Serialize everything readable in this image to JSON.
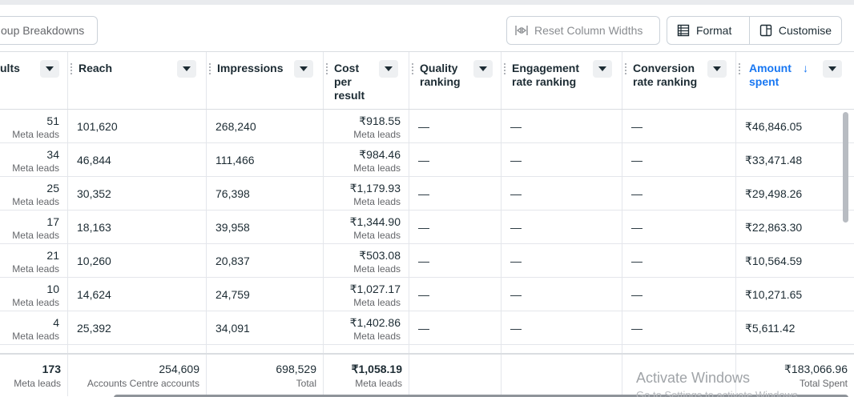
{
  "toolbar": {
    "breakdowns_label": "oup Breakdowns",
    "reset_label": "Reset Column Widths",
    "format_label": "Format",
    "customise_label": "Customise"
  },
  "columns": {
    "results": "ults",
    "reach": "Reach",
    "impressions": "Impressions",
    "cost_l1": "Cost",
    "cost_l2": "per",
    "cost_l3": "result",
    "quality_l1": "Quality",
    "quality_l2": "ranking",
    "engagement_l1": "Engagement",
    "engagement_l2": "rate ranking",
    "conversion_l1": "Conversion",
    "conversion_l2": "rate ranking",
    "amount_l1": "Amount",
    "amount_l2": "spent"
  },
  "rows": [
    {
      "results": "51",
      "results_sub": "Meta leads",
      "reach": "101,620",
      "impressions": "268,240",
      "cost": "₹918.55",
      "cost_sub": "Meta leads",
      "quality": "—",
      "engagement": "—",
      "conversion": "—",
      "amount": "₹46,846.05"
    },
    {
      "results": "34",
      "results_sub": "Meta leads",
      "reach": "46,844",
      "impressions": "111,466",
      "cost": "₹984.46",
      "cost_sub": "Meta leads",
      "quality": "—",
      "engagement": "—",
      "conversion": "—",
      "amount": "₹33,471.48"
    },
    {
      "results": "25",
      "results_sub": "Meta leads",
      "reach": "30,352",
      "impressions": "76,398",
      "cost": "₹1,179.93",
      "cost_sub": "Meta leads",
      "quality": "—",
      "engagement": "—",
      "conversion": "—",
      "amount": "₹29,498.26"
    },
    {
      "results": "17",
      "results_sub": "Meta leads",
      "reach": "18,163",
      "impressions": "39,958",
      "cost": "₹1,344.90",
      "cost_sub": "Meta leads",
      "quality": "—",
      "engagement": "—",
      "conversion": "—",
      "amount": "₹22,863.30"
    },
    {
      "results": "21",
      "results_sub": "Meta leads",
      "reach": "10,260",
      "impressions": "20,837",
      "cost": "₹503.08",
      "cost_sub": "Meta leads",
      "quality": "—",
      "engagement": "—",
      "conversion": "—",
      "amount": "₹10,564.59"
    },
    {
      "results": "10",
      "results_sub": "Meta leads",
      "reach": "14,624",
      "impressions": "24,759",
      "cost": "₹1,027.17",
      "cost_sub": "Meta leads",
      "quality": "—",
      "engagement": "—",
      "conversion": "—",
      "amount": "₹10,271.65"
    },
    {
      "results": "4",
      "results_sub": "Meta leads",
      "reach": "25,392",
      "impressions": "34,091",
      "cost": "₹1,402.86",
      "cost_sub": "Meta leads",
      "quality": "—",
      "engagement": "—",
      "conversion": "—",
      "amount": "₹5,611.42"
    }
  ],
  "totals": {
    "results": "173",
    "results_sub": "Meta leads",
    "reach": "254,609",
    "reach_sub": "Accounts Centre accounts",
    "impressions": "698,529",
    "impressions_sub": "Total",
    "cost": "₹1,058.19",
    "cost_sub": "Meta leads",
    "amount": "₹183,066.96",
    "amount_sub": "Total Spent"
  },
  "watermark": {
    "line1": "Activate Windows",
    "line2": "Go to Settings to activate Windows."
  },
  "colors": {
    "accent": "#1877f2",
    "border": "#dadde1",
    "muted": "#65676b"
  }
}
